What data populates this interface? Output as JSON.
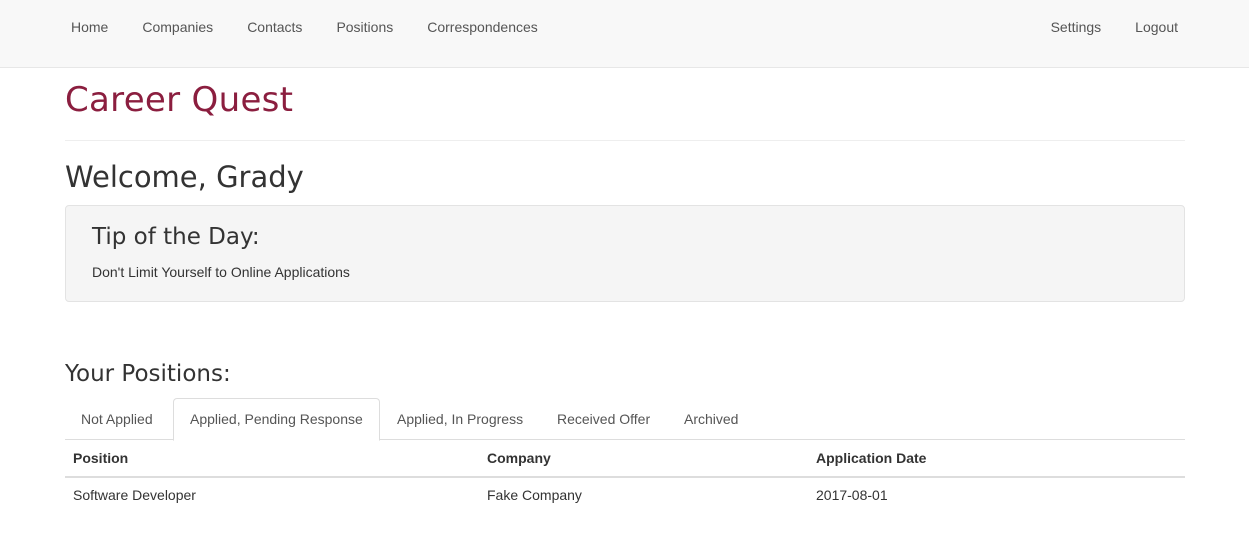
{
  "nav": {
    "left": [
      "Home",
      "Companies",
      "Contacts",
      "Positions",
      "Correspondences"
    ],
    "right": [
      "Settings",
      "Logout"
    ]
  },
  "brand": {
    "title": "Career Quest",
    "color": "#8b1e3f"
  },
  "welcome": "Welcome, Grady",
  "tip": {
    "heading": "Tip of the Day:",
    "text": "Don't Limit Yourself to Online Applications"
  },
  "positions": {
    "heading": "Your Positions:",
    "tabs": [
      "Not Applied",
      "Applied, Pending Response",
      "Applied, In Progress",
      "Received Offer",
      "Archived"
    ],
    "active_tab": "Applied, Pending Response",
    "columns": [
      "Position",
      "Company",
      "Application Date"
    ],
    "rows": [
      [
        "Software Developer",
        "Fake Company",
        "2017-08-01"
      ]
    ]
  }
}
